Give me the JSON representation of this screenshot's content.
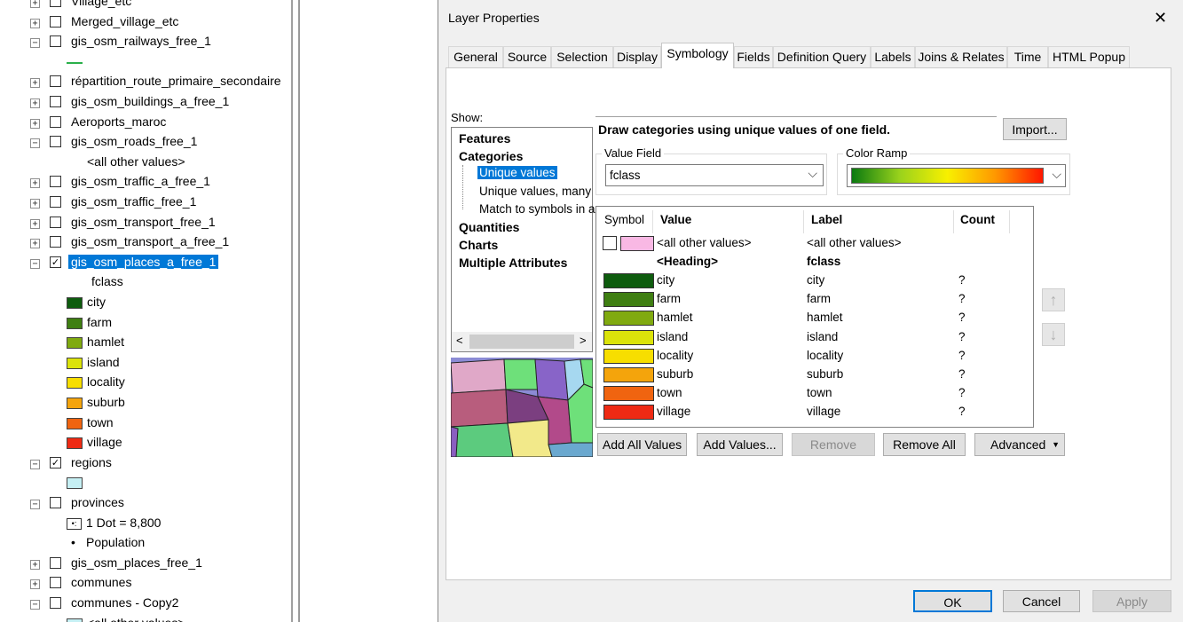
{
  "toc": {
    "layers": [
      {
        "name": "Village_etc",
        "exp": "+",
        "checked": false
      },
      {
        "name": "Merged_village_etc",
        "exp": "+",
        "checked": false
      },
      {
        "name": "gis_osm_railways_free_1",
        "exp": "−",
        "checked": false
      },
      {
        "name": "répartition_route_primaire_secondaire",
        "exp": "+",
        "checked": false
      },
      {
        "name": "gis_osm_buildings_a_free_1",
        "exp": "+",
        "checked": false
      },
      {
        "name": "Aeroports_maroc",
        "exp": "+",
        "checked": false
      },
      {
        "name": "gis_osm_roads_free_1",
        "exp": "−",
        "checked": false
      },
      {
        "name": "gis_osm_traffic_a_free_1",
        "exp": "+",
        "checked": false
      },
      {
        "name": "gis_osm_traffic_free_1",
        "exp": "+",
        "checked": false
      },
      {
        "name": "gis_osm_transport_free_1",
        "exp": "+",
        "checked": false
      },
      {
        "name": "gis_osm_transport_a_free_1",
        "exp": "+",
        "checked": false
      },
      {
        "name": "gis_osm_places_a_free_1",
        "exp": "−",
        "checked": true
      },
      {
        "name": "regions",
        "exp": "−",
        "checked": true
      },
      {
        "name": "provinces",
        "exp": "−",
        "checked": false
      },
      {
        "name": "gis_osm_places_free_1",
        "exp": "+",
        "checked": false
      },
      {
        "name": "communes",
        "exp": "+",
        "checked": false
      },
      {
        "name": "communes - Copy2",
        "exp": "−",
        "checked": false
      }
    ],
    "roads_other": "<all other values>",
    "places_field": "fclass",
    "legend": [
      {
        "label": "city",
        "color": "#0e5c0e"
      },
      {
        "label": "farm",
        "color": "#3f7f12"
      },
      {
        "label": "hamlet",
        "color": "#80aa10"
      },
      {
        "label": "island",
        "color": "#dbe30a"
      },
      {
        "label": "locality",
        "color": "#f7de00"
      },
      {
        "label": "suburb",
        "color": "#f4a40c"
      },
      {
        "label": "town",
        "color": "#f06410"
      },
      {
        "label": "village",
        "color": "#ee2a14"
      }
    ],
    "regions_color": "#c6f0f4",
    "provinces_dot": "1 Dot = 8,800",
    "provinces_field": "Population",
    "communes_other": "<all other values>"
  },
  "dialog": {
    "title": "Layer Properties",
    "close": "✕",
    "tabs": [
      "General",
      "Source",
      "Selection",
      "Display",
      "Symbology",
      "Fields",
      "Definition Query",
      "Labels",
      "Joins & Relates",
      "Time",
      "HTML Popup"
    ],
    "active_tab": "Symbology",
    "show_label": "Show:",
    "show_tree": {
      "features": "Features",
      "categories": "Categories",
      "unique": "Unique values",
      "unique_many": "Unique values, many",
      "match": "Match to symbols in a",
      "quantities": "Quantities",
      "charts": "Charts",
      "multiple": "Multiple Attributes"
    },
    "description": "Draw categories using unique values of one field.",
    "import_label": "Import...",
    "value_field_label": "Value Field",
    "value_field": "fclass",
    "color_ramp_label": "Color Ramp",
    "table_headers": {
      "symbol": "Symbol",
      "value": "Value",
      "label": "Label",
      "count": "Count"
    },
    "other_row": {
      "value": "<all other values>",
      "label": "<all other values>",
      "color": "#f9b8e4"
    },
    "heading_row": {
      "value": "<Heading>",
      "label": "fclass"
    },
    "rows": [
      {
        "value": "city",
        "label": "city",
        "count": "?",
        "color": "#0e5c0e"
      },
      {
        "value": "farm",
        "label": "farm",
        "count": "?",
        "color": "#3f7f12"
      },
      {
        "value": "hamlet",
        "label": "hamlet",
        "count": "?",
        "color": "#80aa10"
      },
      {
        "value": "island",
        "label": "island",
        "count": "?",
        "color": "#dbe30a"
      },
      {
        "value": "locality",
        "label": "locality",
        "count": "?",
        "color": "#f7de00"
      },
      {
        "value": "suburb",
        "label": "suburb",
        "count": "?",
        "color": "#f4a40c"
      },
      {
        "value": "town",
        "label": "town",
        "count": "?",
        "color": "#f06410"
      },
      {
        "value": "village",
        "label": "village",
        "count": "?",
        "color": "#ee2a14"
      }
    ],
    "buttons": {
      "add_all": "Add All Values",
      "add_values": "Add Values...",
      "remove": "Remove",
      "remove_all": "Remove All",
      "advanced": "Advanced"
    },
    "footer": {
      "ok": "OK",
      "cancel": "Cancel",
      "apply": "Apply"
    }
  }
}
